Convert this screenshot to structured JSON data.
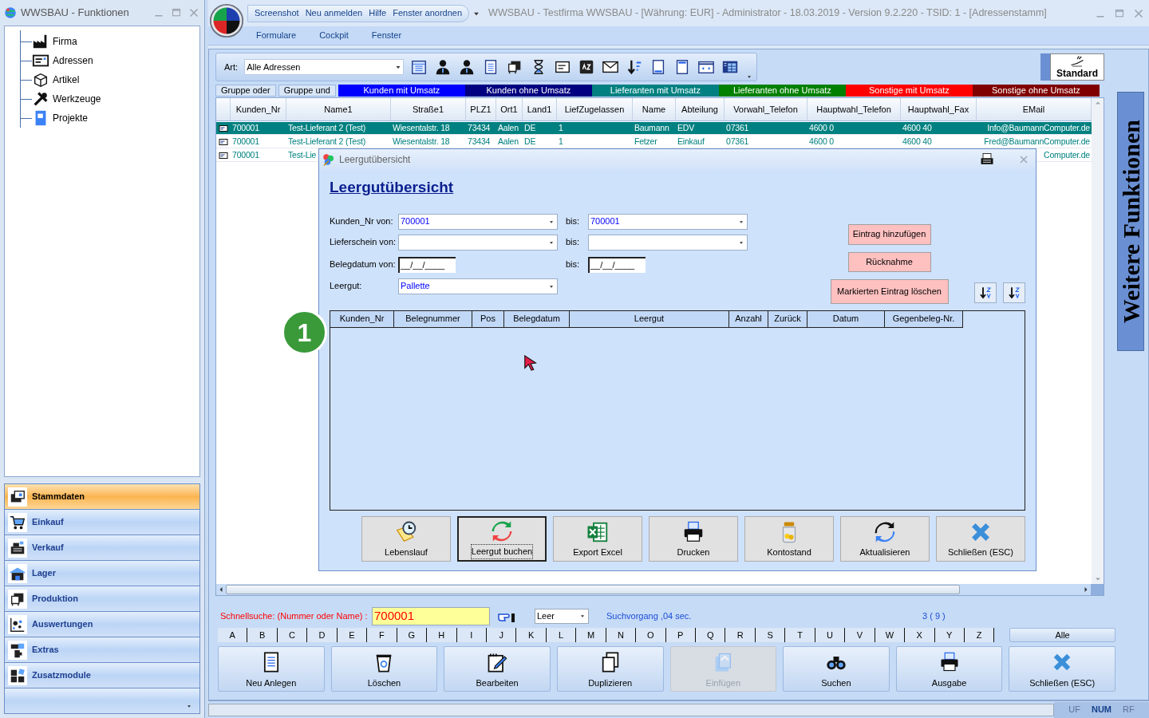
{
  "left_window": {
    "title": "WWSBAU - Funktionen",
    "tree": [
      {
        "label": "Firma"
      },
      {
        "label": "Adressen"
      },
      {
        "label": "Artikel"
      },
      {
        "label": "Werkzeuge"
      },
      {
        "label": "Projekte"
      }
    ],
    "nav": [
      {
        "label": "Stammdaten",
        "selected": true
      },
      {
        "label": "Einkauf",
        "selected": false
      },
      {
        "label": "Verkauf",
        "selected": false
      },
      {
        "label": "Lager",
        "selected": false
      },
      {
        "label": "Produktion",
        "selected": false
      },
      {
        "label": "Auswertungen",
        "selected": false
      },
      {
        "label": "Extras",
        "selected": false
      },
      {
        "label": "Zusatzmodule",
        "selected": false
      }
    ]
  },
  "main_window": {
    "quick_access": [
      "Screenshot",
      "Neu anmelden",
      "Hilfe",
      "Fenster anordnen"
    ],
    "title": "WWSBAU - Testfirma WWSBAU - [Währung: EUR] - Administrator - 18.03.2019 - Version 9.2.220 - TSID: 1  - [Adressenstamm]",
    "menu": [
      "Formulare",
      "Cockpit",
      "Fenster"
    ]
  },
  "toolbar": {
    "art_label": "Art:",
    "art_value": "Alle Adressen",
    "standard_button": "Standard"
  },
  "filters": [
    {
      "label": "Gruppe oder",
      "kind": "plain"
    },
    {
      "label": "Gruppe und",
      "kind": "plain"
    },
    {
      "label": "Kunden mit Umsatz",
      "kind": "colored",
      "color": "#0000ff"
    },
    {
      "label": "Kunden ohne Umsatz",
      "kind": "colored",
      "color": "#000080"
    },
    {
      "label": "Lieferanten mit Umsatz",
      "kind": "colored",
      "color": "#008080"
    },
    {
      "label": "Lieferanten ohne Umsatz",
      "kind": "colored",
      "color": "#008000"
    },
    {
      "label": "Sonstige mit Umsatz",
      "kind": "colored",
      "color": "#ff0000"
    },
    {
      "label": "Sonstige ohne Umsatz",
      "kind": "colored",
      "color": "#800000"
    }
  ],
  "grid": {
    "columns": [
      "Kunden_Nr",
      "Name1",
      "Straße1",
      "PLZ1",
      "Ort1",
      "Land1",
      "LiefZugelassen",
      "Name",
      "Abteilung",
      "Vorwahl_Telefon",
      "Hauptwahl_Telefon",
      "Hauptwahl_Fax",
      "EMail"
    ],
    "rows": [
      {
        "selected": true,
        "cells": [
          "700001",
          "Test-Lieferant 2  (Test)",
          "Wiesentalstr. 18",
          "73434",
          "Aalen",
          "DE",
          "1",
          "Baumann",
          "EDV",
          "07361",
          "4600 0",
          "4600 40",
          "Info@BaumannComputer.de"
        ]
      },
      {
        "selected": false,
        "cells": [
          "700001",
          "Test-Lieferant 2  (Test)",
          "Wiesentalstr. 18",
          "73434",
          "Aalen",
          "DE",
          "1",
          "Fetzer",
          "Einkauf",
          "07361",
          "4600 0",
          "4600 40",
          "Fred@BaumannComputer.de"
        ]
      },
      {
        "selected": false,
        "cells": [
          "700001",
          "Test-Lie",
          null,
          null,
          null,
          null,
          null,
          null,
          null,
          null,
          null,
          null,
          "Computer.de"
        ]
      }
    ]
  },
  "side_tab": "Weitere Funktionen",
  "dialog": {
    "title": "Leergutübersicht",
    "heading": "Leergutübersicht",
    "fields": [
      {
        "kind": "combo",
        "label": "Kunden_Nr von:",
        "from": "700001",
        "to_label": "bis:",
        "to": "700001"
      },
      {
        "kind": "combo",
        "label": "Lieferschein von:",
        "to_label": "bis:"
      },
      {
        "kind": "date",
        "label": "Belegdatum von:",
        "from": "__/__/____",
        "to_label": "bis:",
        "to": "__/__/____"
      },
      {
        "kind": "combo",
        "label": "Leergut:",
        "from": "Pallette"
      }
    ],
    "side_buttons": [
      "Eintrag hinzufügen",
      "Rücknahme",
      "Markierten Eintrag löschen"
    ],
    "columns": [
      "Kunden_Nr",
      "Belegnummer",
      "Pos",
      "Belegdatum",
      "Leergut",
      "Anzahl",
      "Zurück",
      "Datum",
      "Gegenbeleg-Nr."
    ],
    "buttons": [
      {
        "label": "Lebenslauf",
        "focused": false
      },
      {
        "label": "Leergut buchen",
        "focused": true
      },
      {
        "label": "Export Excel",
        "focused": false
      },
      {
        "label": "Drucken",
        "focused": false
      },
      {
        "label": "Kontostand",
        "focused": false
      },
      {
        "label": "Aktualisieren",
        "focused": false
      },
      {
        "label": "Schließen (ESC)",
        "focused": false
      }
    ]
  },
  "badge": "1",
  "quick_search": {
    "label": "Schnellsuche: (Nummer oder Name) :",
    "value": "700001",
    "mode": "Leer",
    "timing": "Suchvorgang ,04 sec.",
    "count": "3 ( 9 )"
  },
  "letters": [
    "A",
    "B",
    "C",
    "D",
    "E",
    "F",
    "G",
    "H",
    "I",
    "J",
    "K",
    "L",
    "M",
    "N",
    "O",
    "P",
    "Q",
    "R",
    "S",
    "T",
    "U",
    "V",
    "W",
    "X",
    "Y",
    "Z"
  ],
  "all_button": "Alle",
  "actions": [
    {
      "label": "Neu Anlegen",
      "disabled": false
    },
    {
      "label": "Löschen",
      "disabled": false
    },
    {
      "label": "Bearbeiten",
      "disabled": false
    },
    {
      "label": "Duplizieren",
      "disabled": false
    },
    {
      "label": "Einfügen",
      "disabled": true
    },
    {
      "label": "Suchen",
      "disabled": false
    },
    {
      "label": "Ausgabe",
      "disabled": false
    },
    {
      "label": "Schließen (ESC)",
      "disabled": false
    }
  ],
  "status_bar": [
    {
      "label": "UF",
      "on": false
    },
    {
      "label": "NUM",
      "on": true
    },
    {
      "label": "RF",
      "on": false
    }
  ]
}
